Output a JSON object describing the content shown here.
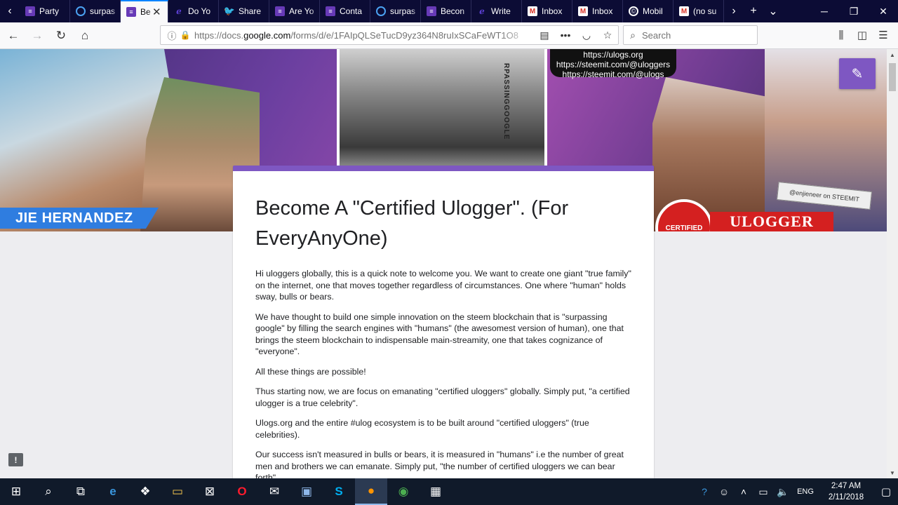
{
  "tabs": [
    {
      "icon": "forms-icon",
      "title": "Party",
      "active": false
    },
    {
      "icon": "steem-icon",
      "title": "surpas",
      "active": false
    },
    {
      "icon": "forms-icon",
      "title": "Be",
      "active": true
    },
    {
      "icon": "ulog-icon",
      "title": "Do Yo",
      "active": false
    },
    {
      "icon": "twitter-icon",
      "title": "Share",
      "active": false
    },
    {
      "icon": "forms-icon",
      "title": "Are Yo",
      "active": false
    },
    {
      "icon": "forms-icon",
      "title": "Conta",
      "active": false
    },
    {
      "icon": "steem-icon",
      "title": "surpas",
      "active": false
    },
    {
      "icon": "forms-icon",
      "title": "Becon",
      "active": false
    },
    {
      "icon": "ulog-icon",
      "title": "Write",
      "active": false
    },
    {
      "icon": "gmail-icon",
      "title": "Inbox",
      "active": false
    },
    {
      "icon": "gmail-icon",
      "title": "Inbox",
      "active": false
    },
    {
      "icon": "mobile-icon",
      "title": "Mobil",
      "active": false
    },
    {
      "icon": "gmail-icon",
      "title": "(no su",
      "active": false
    }
  ],
  "navbar": {
    "url_prefix": "https://docs.",
    "url_host": "google.com",
    "url_rest": "/forms/d/e/1FAIpQLSeTucD9yz364N8ruIxSCaFeWT1O8",
    "search_placeholder": "Search"
  },
  "banner": {
    "steem_links": [
      "https://ulogs.org",
      "https://steemit.com/@uloggers",
      "https://steemit.com/@ulogs"
    ],
    "name_tag": "JIE HERNANDEZ",
    "ulogger_tag": "ULOGGER",
    "seal_text": "CERTIFIED",
    "handle_tag": "@enjieneer on STEEMIT",
    "vertical_text": "RPASSINGGOOGLE"
  },
  "form": {
    "title": "Become A \"Certified Ulogger\". (For EveryAnyOne)",
    "paragraphs": [
      "Hi uloggers globally, this is a quick note to welcome you. We want to create one giant \"true family\" on the internet, one that moves together regardless of circumstances. One where \"human\" holds sway, bulls or bears.",
      "We have thought to build one simple innovation on the steem blockchain that is \"surpassing google\" by filling the search engines with \"humans\" (the awesomest version of human), one that brings the steem blockchain to indispensable main-streamity, one that takes cognizance of \"everyone\".",
      "All these things are possible!",
      "Thus starting now, we are focus on emanating \"certified uloggers\" globally. Simply put, \"a certified ulogger is a true celebrity\".",
      "Ulogs.org and the entire #ulog ecosystem is to be built around \"certified uloggers\" (true celebrities).",
      "Our success isn't measured in bulls or bears, it is measured in \"humans\" i.e the number of great men and brothers we can emanate. Simply put, \"the number of certified uloggers we can bear forth\"."
    ]
  },
  "taskbar": {
    "lang": "ENG",
    "time": "2:47 AM",
    "date": "2/11/2018"
  },
  "colors": {
    "form_accent": "#7e57c2",
    "tabstrip_bg": "#0c0c35",
    "page_bg": "#ededf0"
  }
}
